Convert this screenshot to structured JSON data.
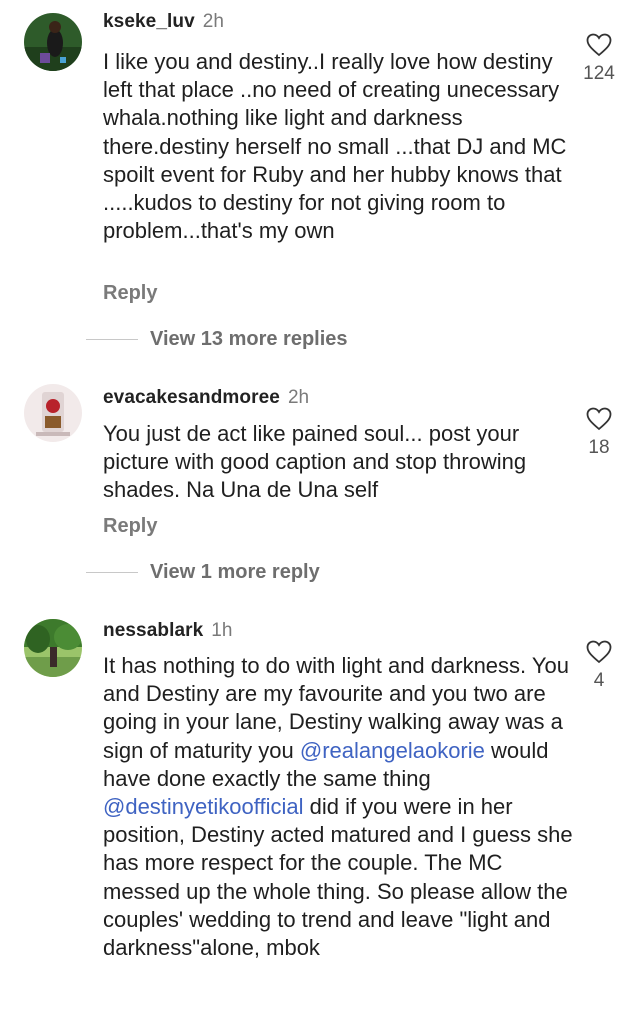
{
  "comments": [
    {
      "username": "kseke_luv",
      "time": "2h",
      "text": "I like you and destiny..I really love how destiny left that place ..no need of creating unecessary whala.nothing like light and darkness there.destiny herself no small ...that DJ and MC spoilt event for Ruby and her hubby knows that .....kudos to destiny for not giving room to problem...that's my own",
      "likes": "124",
      "reply_label": "Reply",
      "view_replies": "View 13 more replies",
      "avatar_colors": [
        "#2e5b2a",
        "#1a1a1a"
      ]
    },
    {
      "username": "evacakesandmoree",
      "time": "2h",
      "text": "You just de act like pained soul... post your picture with good caption and stop throwing shades. Na Una de Una self",
      "likes": "18",
      "reply_label": "Reply",
      "view_replies": "View 1 more reply",
      "avatar_colors": [
        "#f2eaea",
        "#b8222b"
      ]
    },
    {
      "username": "nessablark",
      "time": "1h",
      "text_before_mention1": "It has nothing to do with light and darkness. You and Destiny are my favourite and you two are going in your lane, Destiny walking away was a sign of maturity you ",
      "mention1": "@realangelaokorie",
      "text_between": " would have done exactly the same thing ",
      "mention2": "@destinyetikoofficial",
      "text_after": " did if you were in her position, Destiny acted matured and I guess she has more respect for the couple. The MC messed up the whole thing. So please allow the couples' wedding to trend and leave \"light and darkness\"alone, mbok",
      "likes": "4",
      "avatar_colors": [
        "#3d7a2c",
        "#9bc46a"
      ]
    }
  ],
  "icons": {
    "like": "heart-outline-icon"
  },
  "colors": {
    "mention": "#3f63c2",
    "secondary_text": "#7a7a7a"
  }
}
